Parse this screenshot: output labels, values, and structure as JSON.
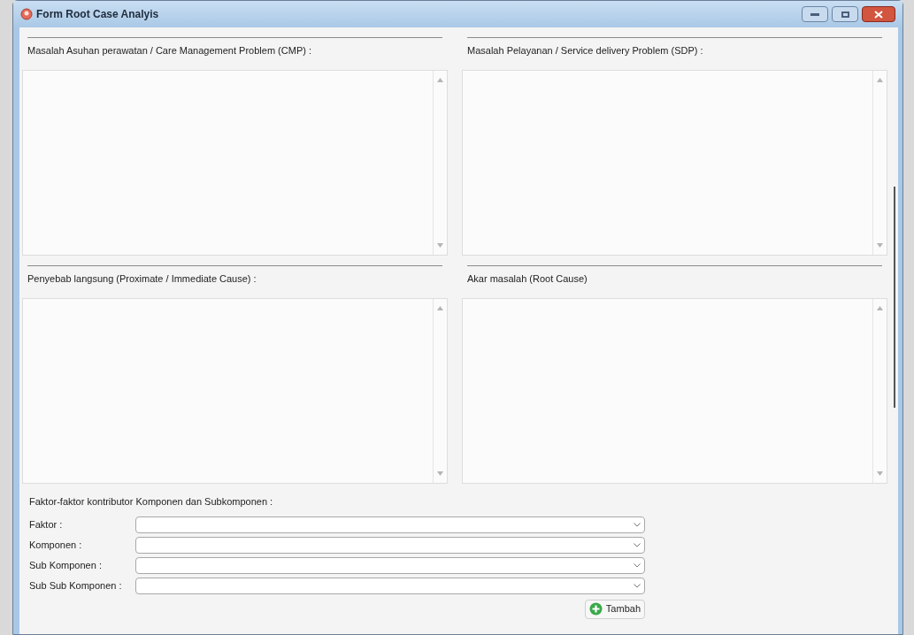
{
  "window": {
    "title": "Form Root Case Analyis"
  },
  "text_areas": [
    {
      "label": "Masalah Asuhan perawatan / Care Management Problem (CMP) :"
    },
    {
      "label": "Masalah Pelayanan / Service delivery Problem (SDP) :"
    },
    {
      "label": "Penyebab langsung (Proximate / Immediate Cause) :"
    },
    {
      "label": "Akar masalah (Root Cause)"
    }
  ],
  "contributors": {
    "title": "Faktor-faktor kontributor Komponen dan Subkomponen :",
    "fields": [
      {
        "label": "Faktor :"
      },
      {
        "label": "Komponen :"
      },
      {
        "label": "Sub Komponen :"
      },
      {
        "label": "Sub Sub Komponen :"
      }
    ],
    "button": "Tambah"
  }
}
